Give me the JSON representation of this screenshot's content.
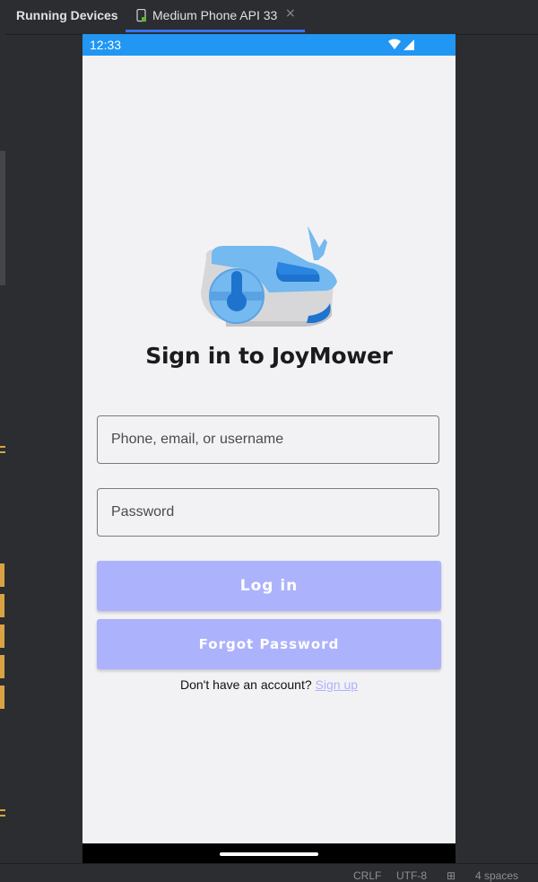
{
  "ide": {
    "panel_title": "Running Devices",
    "device_tab": "Medium Phone API 33",
    "close_glyph": "×",
    "status": {
      "line_sep": "CRLF",
      "encoding": "UTF-8",
      "indent": "4 spaces"
    }
  },
  "phone": {
    "status_bar": {
      "time": "12:33",
      "icons": [
        "wifi-icon",
        "signal-icon"
      ]
    },
    "logo": "robot-mower-icon",
    "heading": "Sign in to JoyMower",
    "fields": {
      "username_placeholder": "Phone, email, or username",
      "username_value": "",
      "password_placeholder": "Password",
      "password_value": ""
    },
    "buttons": {
      "login": "Log in",
      "forgot": "Forgot Password"
    },
    "signup": {
      "prompt": "Don't have an account?",
      "link": "Sign up"
    }
  },
  "colors": {
    "status_bar": "#2196f3",
    "button": "#adb2fd",
    "link": "#adb2fd",
    "background": "#f2f2f4",
    "ide_background": "#2b2d30"
  }
}
